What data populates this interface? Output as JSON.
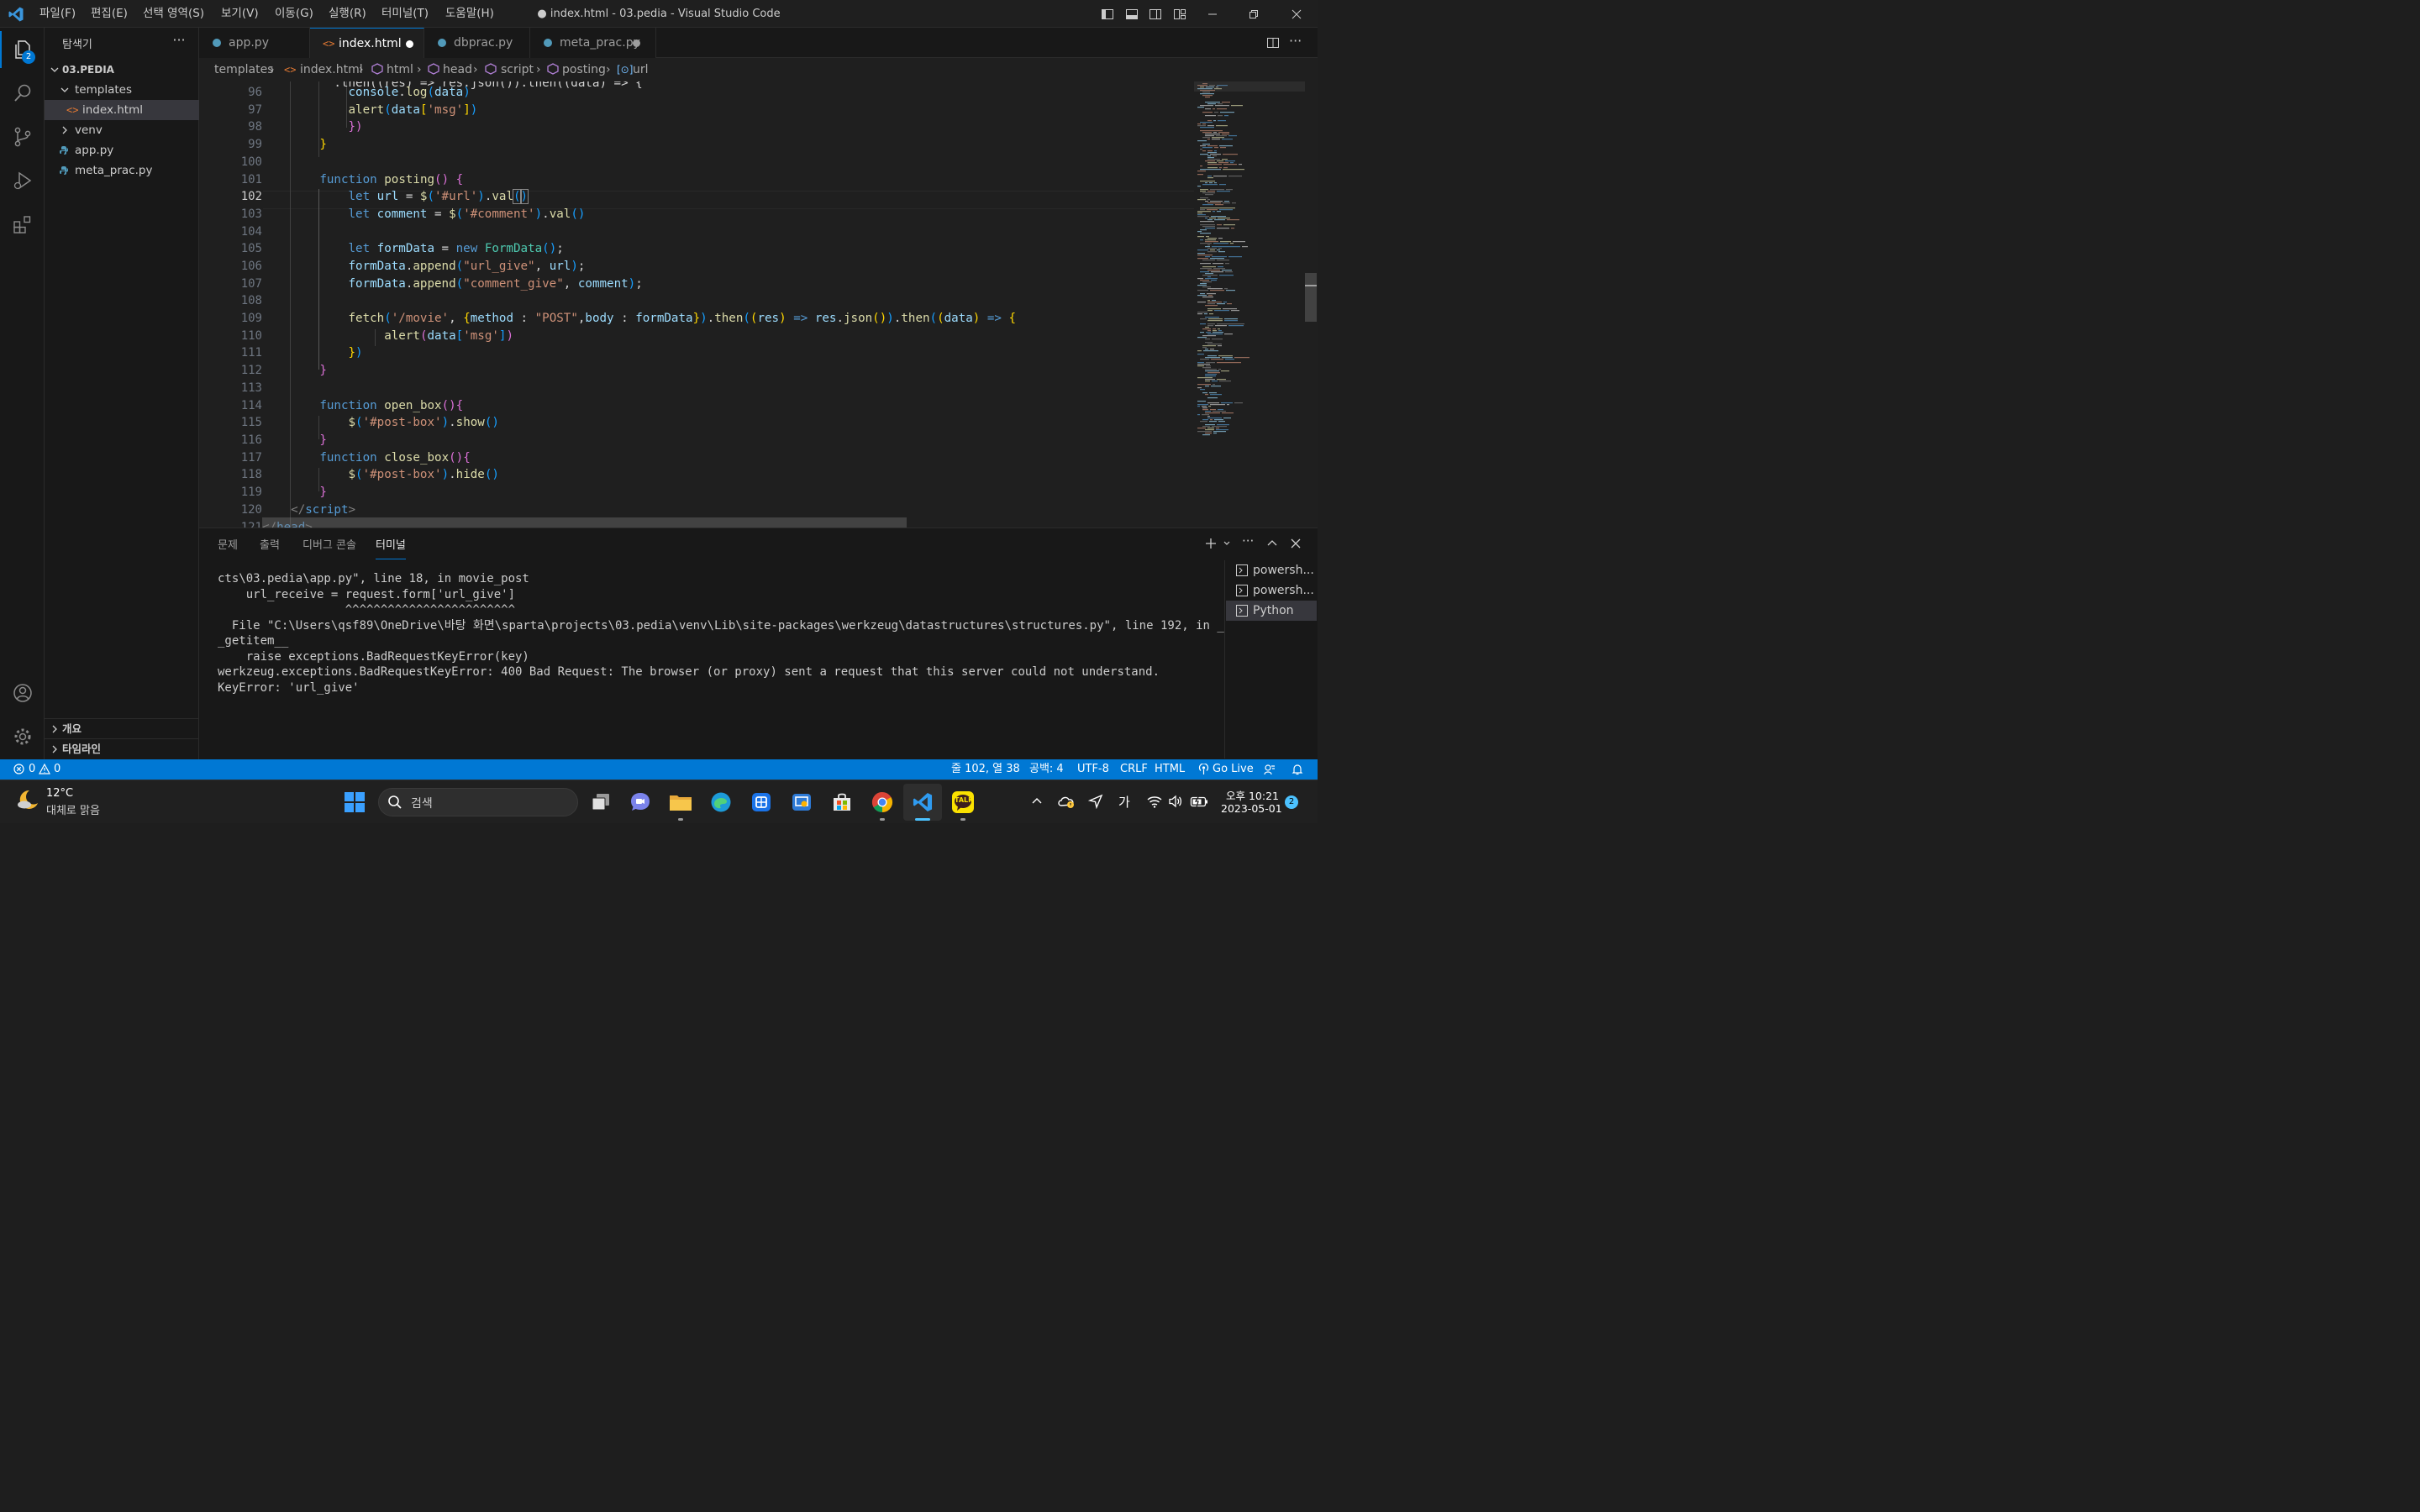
{
  "window": {
    "title": "● index.html - 03.pedia - Visual Studio Code"
  },
  "menu": [
    "파일(F)",
    "편집(E)",
    "선택 영역(S)",
    "보기(V)",
    "이동(G)",
    "실행(R)",
    "터미널(T)",
    "도움말(H)"
  ],
  "activity": {
    "explorer_badge": "2"
  },
  "sidebar": {
    "title": "탐색기",
    "folder": "03.PEDIA",
    "items": [
      {
        "label": "templates"
      },
      {
        "label": "index.html"
      },
      {
        "label": "venv"
      },
      {
        "label": "app.py"
      },
      {
        "label": "meta_prac.py"
      }
    ],
    "outline": "개요",
    "timeline": "타임라인"
  },
  "tabs": [
    {
      "label": "app.py"
    },
    {
      "label": "index.html"
    },
    {
      "label": "dbprac.py"
    },
    {
      "label": "meta_prac.py"
    }
  ],
  "breadcrumb": [
    "templates",
    "index.html",
    "html",
    "head",
    "script",
    "posting",
    "url"
  ],
  "editor": {
    "line_numbers": [
      "96",
      "97",
      "98",
      "99",
      "100",
      "101",
      "102",
      "103",
      "104",
      "105",
      "106",
      "107",
      "108",
      "109",
      "110",
      "111",
      "112",
      "113",
      "114",
      "115",
      "116",
      "117",
      "118",
      "119",
      "120",
      "121"
    ],
    "current_line": "102"
  },
  "panel": {
    "tabs": [
      "문제",
      "출력",
      "디버그 콘솔",
      "터미널"
    ],
    "terminal_lines": [
      "cts\\03.pedia\\app.py\", line 18, in movie_post",
      "    url_receive = request.form['url_give']",
      "                  ^^^^^^^^^^^^^^^^^^^^^^^^",
      "  File \"C:\\Users\\qsf89\\OneDrive\\바탕 화면\\sparta\\projects\\03.pedia\\venv\\Lib\\site-packages\\werkzeug\\datastructures\\structures.py\", line 192, in _",
      "_getitem__",
      "    raise exceptions.BadRequestKeyError(key)",
      "werkzeug.exceptions.BadRequestKeyError: 400 Bad Request: The browser (or proxy) sent a request that this server could not understand.",
      "KeyError: 'url_give'"
    ],
    "terminals": [
      "powersh...",
      "powersh...",
      "Python"
    ]
  },
  "status": {
    "errors": "0",
    "warnings": "0",
    "position": "줄 102, 열 38",
    "spaces": "공백: 4",
    "encoding": "UTF-8",
    "eol": "CRLF",
    "language": "HTML",
    "golive": "Go Live"
  },
  "taskbar": {
    "temp": "12°C",
    "weather": "대체로 맑음",
    "search": "검색",
    "ime": "가",
    "time": "오후 10:21",
    "date": "2023-05-01",
    "notif": "2",
    "talk": "TALK"
  },
  "colors": {
    "accent": "#0078d4",
    "status_bg": "#0078d4",
    "editor_bg": "#1f1f1f",
    "sidebar_bg": "#181818"
  }
}
